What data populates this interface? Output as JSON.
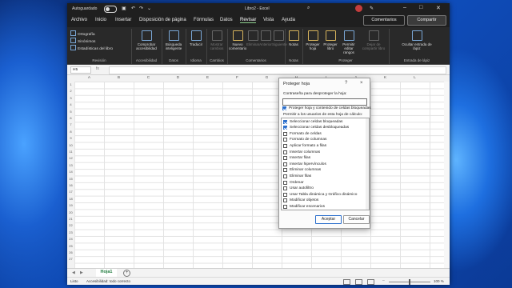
{
  "titlebar": {
    "autosave_label": "Autoguardado",
    "document_title": "Libro2  -  Excel"
  },
  "menu": {
    "items": [
      "Archivo",
      "Inicio",
      "Insertar",
      "Disposición de página",
      "Fórmulas",
      "Datos",
      "Revisar",
      "Vista",
      "Ayuda"
    ],
    "active": "Revisar",
    "comments_button": "Comentarios",
    "share_button": "Compartir"
  },
  "ribbon": {
    "revision": {
      "label": "Revisión",
      "items": [
        "Ortografía",
        "Sinónimos",
        "Estadísticas del libro"
      ]
    },
    "accesibilidad": {
      "label": "Accesibilidad",
      "button": "Comprobar accesibilidad"
    },
    "datos": {
      "label": "Datos",
      "button": "Búsqueda inteligente"
    },
    "idioma": {
      "label": "Idioma",
      "button": "Traducir"
    },
    "cambios": {
      "label": "Cambios",
      "button": "Mostrar cambios"
    },
    "comentarios": {
      "label": "Comentarios",
      "buttons": [
        "Nuevo comentario",
        "Eliminar",
        "Anterior",
        "Siguiente"
      ]
    },
    "notas": {
      "label": "Notas",
      "button": "Notas"
    },
    "proteger": {
      "label": "Proteger",
      "buttons": [
        "Proteger hoja",
        "Proteger libro",
        "Permitir editar rangos",
        "Dejar de compartir libro"
      ]
    },
    "entrada": {
      "label": "Entrada de lápiz",
      "button": "Ocultar entrada de lápiz"
    }
  },
  "formula_bar": {
    "cell_ref": "H5",
    "fx": "fx"
  },
  "grid": {
    "columns": [
      "A",
      "B",
      "C",
      "D",
      "E",
      "F",
      "G",
      "H",
      "I",
      "J",
      "K",
      "L"
    ],
    "rows": [
      "1",
      "2",
      "3",
      "4",
      "5",
      "6",
      "7",
      "8",
      "9",
      "10",
      "11",
      "12",
      "13",
      "14",
      "15",
      "16",
      "17",
      "18",
      "19",
      "20",
      "21",
      "22",
      "23",
      "24",
      "25",
      "26",
      "27"
    ]
  },
  "sheet_tabs": {
    "active": "Hoja1",
    "add": "+"
  },
  "status": {
    "ready": "Listo",
    "accessibility": "Accesibilidad: todo correcto",
    "zoom": "100 %"
  },
  "dialog": {
    "title": "Proteger hoja",
    "help": "?",
    "close": "×",
    "password_label": "Contraseña para desproteger la hoja:",
    "protect_checkbox": "Proteger hoja y contenido de celdas bloqueadas",
    "protect_checked": true,
    "allow_label": "Permitir a los usuarios de esta hoja de cálculo:",
    "permissions": [
      {
        "label": "Seleccionar celdas bloqueadas",
        "checked": true
      },
      {
        "label": "Seleccionar celdas desbloqueadas",
        "checked": true
      },
      {
        "label": "Formato de celdas",
        "checked": false
      },
      {
        "label": "Formato de columnas",
        "checked": false
      },
      {
        "label": "Aplicar formato a filas",
        "checked": false
      },
      {
        "label": "Insertar columnas",
        "checked": false
      },
      {
        "label": "Insertar filas",
        "checked": false
      },
      {
        "label": "Insertar hipervínculos",
        "checked": false
      },
      {
        "label": "Eliminar columnas",
        "checked": false
      },
      {
        "label": "Eliminar filas",
        "checked": false
      },
      {
        "label": "Ordenar",
        "checked": false
      },
      {
        "label": "Usar autofiltro",
        "checked": false
      },
      {
        "label": "Usar Tabla dinámica y Gráfico dinámico",
        "checked": false
      },
      {
        "label": "Modificar objetos",
        "checked": false
      },
      {
        "label": "Modificar escenarios",
        "checked": false
      }
    ],
    "ok_button": "Aceptar",
    "cancel_button": "Cancelar"
  }
}
